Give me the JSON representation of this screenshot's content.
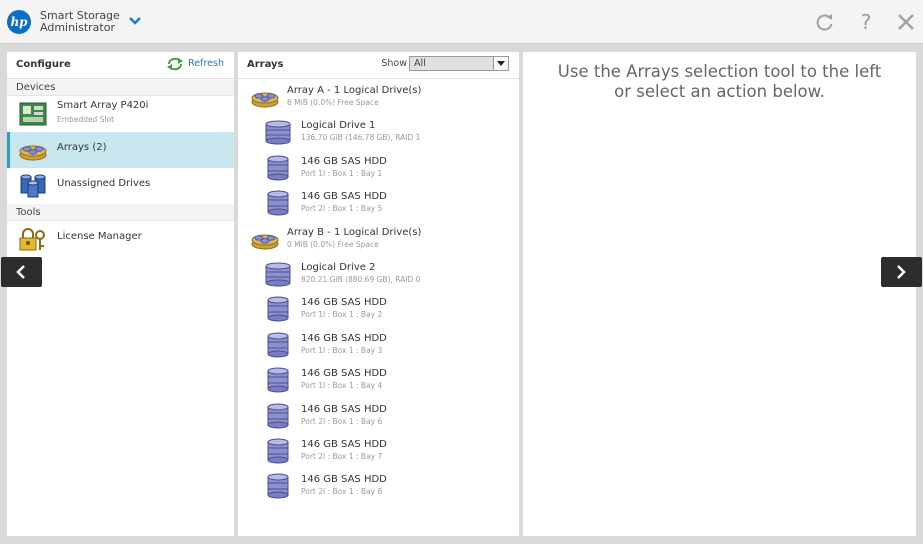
{
  "header": {
    "logo_text": "hp",
    "title_line1": "Smart Storage",
    "title_line2": "Administrator",
    "help_glyph": "?"
  },
  "left_panel": {
    "title": "Configure",
    "refresh_label": "Refresh",
    "devices_label": "Devices",
    "tools_label": "Tools",
    "items": [
      {
        "label": "Smart Array P420i",
        "sub": "Embedded Slot",
        "icon": "controller-icon"
      },
      {
        "label": "Arrays (2)",
        "sub": "",
        "icon": "arrays-icon"
      },
      {
        "label": "Unassigned Drives",
        "sub": "",
        "icon": "unassigned-drives-icon"
      }
    ],
    "tools": [
      {
        "label": "License Manager",
        "icon": "license-icon"
      }
    ]
  },
  "mid_panel": {
    "title": "Arrays",
    "show_label": "Show",
    "show_value": "All",
    "rows": [
      {
        "type": "array",
        "name": "Array A - 1 Logical Drive(s)",
        "sub": "6 MiB (0.0%) Free Space"
      },
      {
        "type": "logical",
        "name": "Logical Drive 1",
        "sub": "136.70 GiB (146.78 GB), RAID 1"
      },
      {
        "type": "disk",
        "name": "146 GB SAS HDD",
        "sub": "Port 1I : Box 1 : Bay 1"
      },
      {
        "type": "disk",
        "name": "146 GB SAS HDD",
        "sub": "Port 2I : Box 1 : Bay 5"
      },
      {
        "type": "array",
        "name": "Array B - 1 Logical Drive(s)",
        "sub": "0 MiB (0.0%) Free Space"
      },
      {
        "type": "logical",
        "name": "Logical Drive 2",
        "sub": "820.21 GiB (880.69 GB), RAID 0"
      },
      {
        "type": "disk",
        "name": "146 GB SAS HDD",
        "sub": "Port 1I : Box 1 : Bay 2"
      },
      {
        "type": "disk",
        "name": "146 GB SAS HDD",
        "sub": "Port 1I : Box 1 : Bay 3"
      },
      {
        "type": "disk",
        "name": "146 GB SAS HDD",
        "sub": "Port 1I : Box 1 : Bay 4"
      },
      {
        "type": "disk",
        "name": "146 GB SAS HDD",
        "sub": "Port 2I : Box 1 : Bay 6"
      },
      {
        "type": "disk",
        "name": "146 GB SAS HDD",
        "sub": "Port 2I : Box 1 : Bay 7"
      },
      {
        "type": "disk",
        "name": "146 GB SAS HDD",
        "sub": "Port 2I : Box 1 : Bay 8"
      }
    ]
  },
  "right_panel": {
    "message_line1": "Use the Arrays selection tool to the left",
    "message_line2": "or select an action below."
  },
  "colors": {
    "accent": "#28a0c0",
    "selected_bg": "#c7e6ee",
    "link": "#2a7ab8",
    "hp_blue": "#0a6fc2"
  }
}
